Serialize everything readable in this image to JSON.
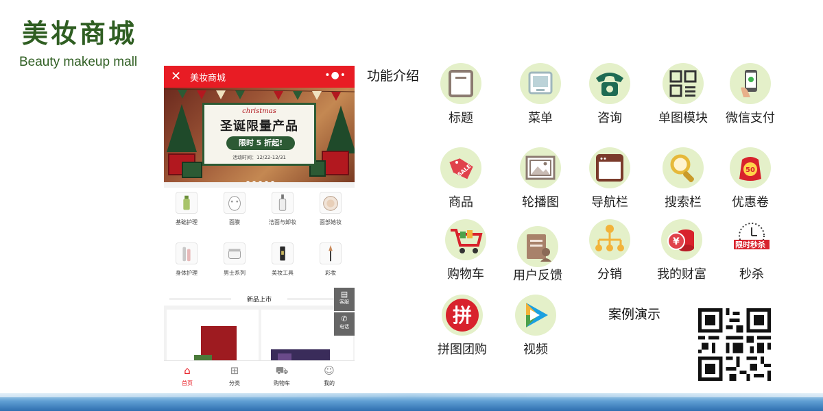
{
  "brand": {
    "title": "美妆商城",
    "subtitle": "Beauty makeup mall"
  },
  "phone": {
    "nav": {
      "close_icon": "close-icon",
      "title": "美妆商城",
      "more_icon": "more-dots-icon"
    },
    "banner": {
      "script_text": "christmas",
      "headline": "圣诞限量产品",
      "promo_text": "限时 5 折起!",
      "event_dates": "活动时间：12/22-12/31",
      "slide_count": 5
    },
    "categories": [
      {
        "label": "基础护理",
        "icon": "serum-bottle-icon"
      },
      {
        "label": "面膜",
        "icon": "face-mask-icon"
      },
      {
        "label": "洁面与卸妆",
        "icon": "cleanser-bottle-icon"
      },
      {
        "label": "面部她妆",
        "icon": "compact-powder-icon"
      },
      {
        "label": "身体护理",
        "icon": "body-care-icon"
      },
      {
        "label": "男士系列",
        "icon": "cream-jar-icon"
      },
      {
        "label": "美妆工具",
        "icon": "beauty-tool-icon"
      },
      {
        "label": "彩妆",
        "icon": "makeup-brush-icon"
      }
    ],
    "section_title": "新品上市",
    "floating": [
      {
        "label": "客服",
        "icon": "chat-icon"
      },
      {
        "label": "电话",
        "icon": "phone-icon"
      }
    ],
    "tabs": [
      {
        "label": "首页",
        "icon": "home-icon",
        "active": true
      },
      {
        "label": "分类",
        "icon": "grid-icon",
        "active": false
      },
      {
        "label": "购物车",
        "icon": "cart-icon",
        "active": false
      },
      {
        "label": "我的",
        "icon": "user-icon",
        "active": false
      }
    ]
  },
  "features": {
    "heading": "功能介绍",
    "items": [
      {
        "label": "标题",
        "icon": "title-square-icon"
      },
      {
        "label": "菜单",
        "icon": "menu-monitor-icon"
      },
      {
        "label": "咨询",
        "icon": "telephone-icon"
      },
      {
        "label": "单图模块",
        "icon": "image-module-icon"
      },
      {
        "label": "微信支付",
        "icon": "wechat-pay-icon"
      },
      {
        "label": "商品",
        "icon": "sale-tag-icon"
      },
      {
        "label": "轮播图",
        "icon": "carousel-image-icon"
      },
      {
        "label": "导航栏",
        "icon": "nav-window-icon"
      },
      {
        "label": "搜索栏",
        "icon": "magnifier-icon"
      },
      {
        "label": "优惠卷",
        "icon": "coupon-bag-icon"
      },
      {
        "label": "购物车",
        "icon": "shopping-cart-icon"
      },
      {
        "label": "用户反馈",
        "icon": "feedback-doc-icon"
      },
      {
        "label": "分销",
        "icon": "distribution-tree-icon"
      },
      {
        "label": "我的财富",
        "icon": "coins-icon"
      },
      {
        "label": "秒杀",
        "icon": "flash-sale-clock-icon"
      },
      {
        "label": "拼图团购",
        "icon": "group-buy-icon"
      },
      {
        "label": "视频",
        "icon": "video-play-icon"
      }
    ]
  },
  "feature_glyphs": {
    "group_buy": "拼",
    "coupon": "50",
    "flash_sale": "限时秒杀",
    "sale_tag": "SALE",
    "coin": "¥"
  },
  "demo": {
    "heading": "案例演示",
    "qr_icon": "qr-code-icon"
  },
  "colors": {
    "brand_green": "#2f5e22",
    "app_red": "#e81c24",
    "feature_bg": "#e4f0c9"
  }
}
